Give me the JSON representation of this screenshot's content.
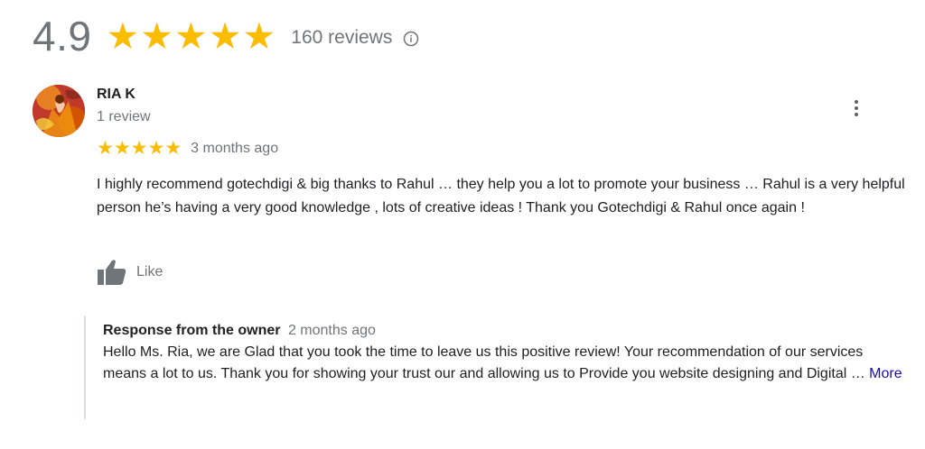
{
  "summary": {
    "score": "4.9",
    "stars": 5,
    "review_count": "160 reviews",
    "info_icon": "info-icon"
  },
  "review": {
    "author": "RIA K",
    "author_meta": "1 review",
    "rating": 5,
    "date": "3 months ago",
    "text": "I highly recommend gotechdigi & big thanks to Rahul … they help you a lot to promote your business … Rahul is a very helpful person he’s having a very good knowledge , lots of creative ideas ! Thank you Gotechdigi & Rahul once again !",
    "like_label": "Like",
    "like_icon": "thumbs-up-icon",
    "menu_icon": "more-vert-icon"
  },
  "owner_response": {
    "title": "Response from the owner",
    "date": "2 months ago",
    "text": "Hello Ms. Ria, we are Glad that you took the time to leave us this positive review! Your recommendation of our services means a lot to us. Thank you for showing your trust our and allowing us to Provide you website designing and Digital … ",
    "more_label": "More"
  },
  "colors": {
    "star": "#fbbc04",
    "muted_text": "#70757a",
    "link": "#1a0dab"
  }
}
